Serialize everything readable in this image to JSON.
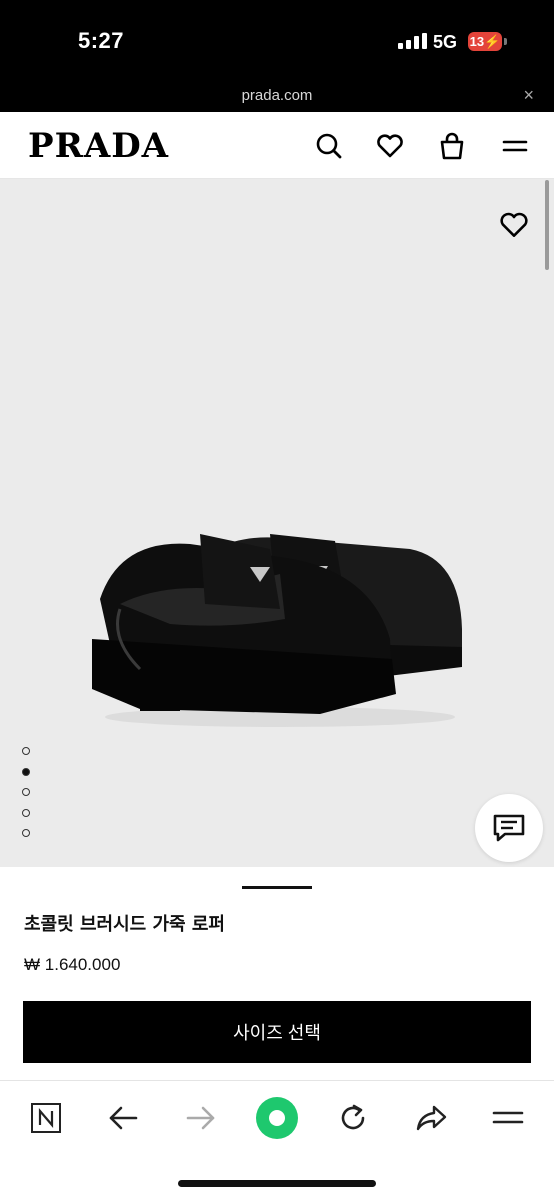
{
  "status": {
    "time": "5:27",
    "network": "5G",
    "battery": "13"
  },
  "browser": {
    "url": "prada.com",
    "close_symbol": "×"
  },
  "header": {
    "logo": "PRADA"
  },
  "product": {
    "title": "초콜릿 브러시드 가죽 로퍼",
    "price": "₩ 1.640.000",
    "cta_label": "사이즈 선택",
    "gallery_active_index": 1,
    "gallery_count": 5
  },
  "icons": {
    "header": [
      "search-icon",
      "heart-icon",
      "shopping-bag-icon",
      "menu-icon"
    ],
    "toolbar": [
      "naver-n-icon",
      "back-arrow-icon",
      "forward-arrow-icon",
      "home-green-icon",
      "refresh-icon",
      "share-icon",
      "menu-icon"
    ]
  },
  "colors": {
    "accent_green": "#1ec86e",
    "battery_red": "#e3443a"
  }
}
